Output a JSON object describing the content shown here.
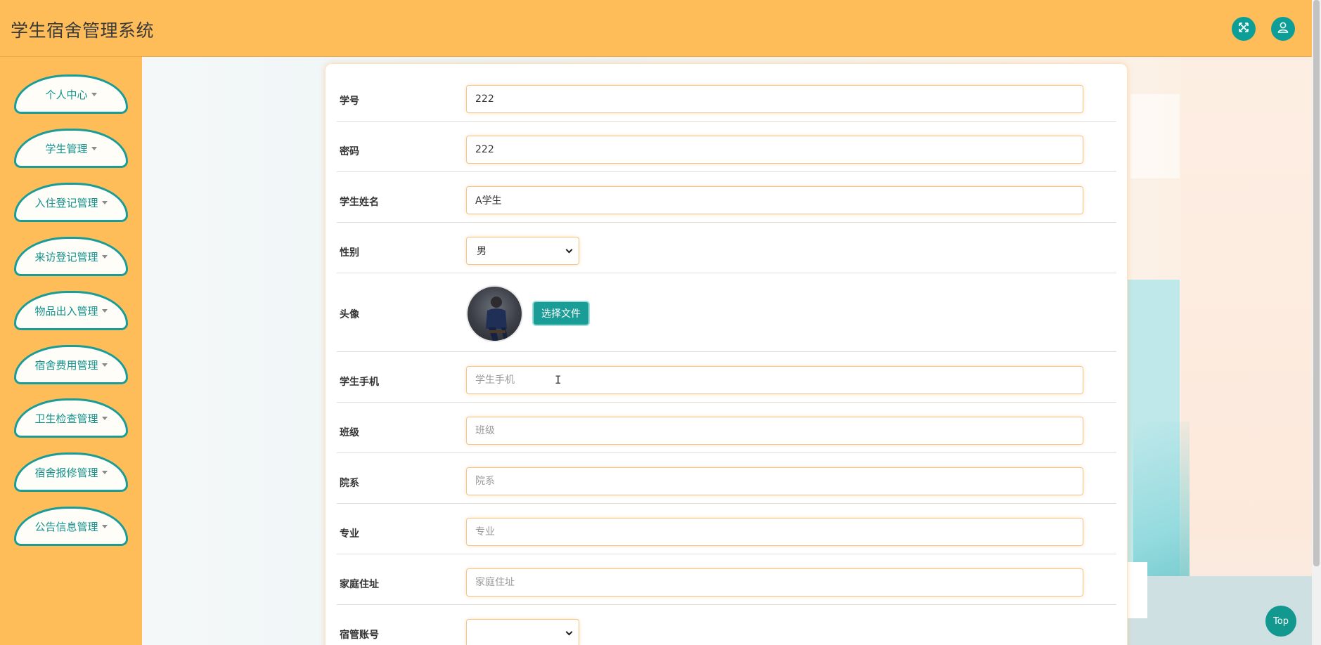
{
  "app": {
    "title": "学生宿舍管理系统"
  },
  "header": {
    "fullscreen_icon": "fullscreen-icon",
    "user_icon": "user-icon"
  },
  "sidebar": {
    "items": [
      {
        "label": "个人中心"
      },
      {
        "label": "学生管理"
      },
      {
        "label": "入住登记管理"
      },
      {
        "label": "来访登记管理"
      },
      {
        "label": "物品出入管理"
      },
      {
        "label": "宿舍费用管理"
      },
      {
        "label": "卫生检查管理"
      },
      {
        "label": "宿舍报修管理"
      },
      {
        "label": "公告信息管理"
      }
    ]
  },
  "form": {
    "student_no": {
      "label": "学号",
      "value": "222"
    },
    "password": {
      "label": "密码",
      "value": "222"
    },
    "name": {
      "label": "学生姓名",
      "value": "A学生"
    },
    "gender": {
      "label": "性别",
      "value": "男"
    },
    "avatar": {
      "label": "头像",
      "button": "选择文件"
    },
    "phone": {
      "label": "学生手机",
      "placeholder": "学生手机"
    },
    "class": {
      "label": "班级",
      "placeholder": "班级"
    },
    "department": {
      "label": "院系",
      "placeholder": "院系"
    },
    "major": {
      "label": "专业",
      "placeholder": "专业"
    },
    "address": {
      "label": "家庭住址",
      "placeholder": "家庭住址"
    },
    "dorm_manager": {
      "label": "宿管账号",
      "value": ""
    }
  },
  "top_button": {
    "label": "Top"
  },
  "colors": {
    "header_bg": "#ffbd59",
    "accent": "#1a9c97",
    "field_border": "#f3c48a"
  }
}
